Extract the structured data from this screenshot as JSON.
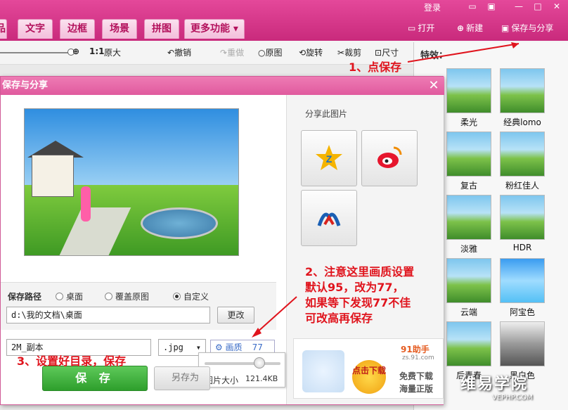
{
  "window": {
    "login": "登录"
  },
  "nav_tabs": [
    "品",
    "文字",
    "边框",
    "场景",
    "拼图",
    "更多功能"
  ],
  "top_buttons": {
    "open": "打开",
    "new": "新建",
    "save_share": "保存与分享"
  },
  "toolbar": {
    "ratio": "1:1",
    "original_size": "原大",
    "undo": "撤销",
    "redo": "重做",
    "original": "原图",
    "rotate": "旋转",
    "crop": "裁剪",
    "size": "尺寸"
  },
  "effects_panel": {
    "title": "特效：",
    "items": [
      "柔光",
      "经典lomo",
      "复古",
      "粉红佳人",
      "淡雅",
      "HDR",
      "云端",
      "阿宝色",
      "后青春",
      "黑白色"
    ]
  },
  "dialog": {
    "title": "保存与分享",
    "share_label": "分享此图片",
    "path_label": "保存路径",
    "path_options": [
      "桌面",
      "覆盖原图",
      "自定义"
    ],
    "path_value": "d:\\我的文档\\桌面",
    "change_button": "更改",
    "filename_value": "2M_副本",
    "format_value": ".jpg",
    "quality_label": "画质",
    "quality_value": "77",
    "size_label": "图片大小",
    "size_value": "121.4KB",
    "save_button": "保 存",
    "save_as_button": "另存为",
    "ad_top": "91助手",
    "ad_top_small": "zs.91.com",
    "ad_badge": "点击下载",
    "ad_text1": "免费下载",
    "ad_text2": "海量正版"
  },
  "annotations": {
    "step1": "1、点保存",
    "step2": [
      "2、注意这里画质设置",
      "默认95，改为77，",
      "如果等下发现77不佳",
      "可改高再保存"
    ],
    "step3": "3、设置好目录，保存"
  },
  "watermark": {
    "main": "维易学院",
    "sub": "VEPHP.COM"
  }
}
